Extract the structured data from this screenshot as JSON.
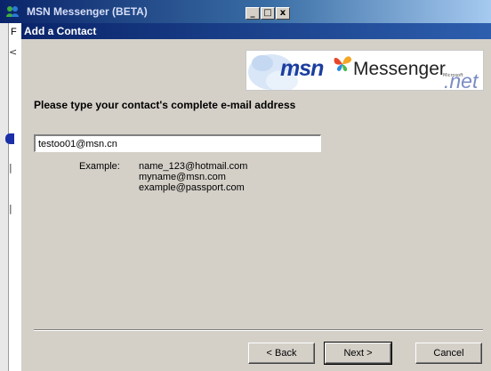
{
  "background_window": {
    "title": "MSN Messenger (BETA)",
    "controls": {
      "minimize": "_",
      "maximize": "□",
      "close": "x"
    },
    "menu_letter": "F",
    "marks": [
      "<",
      "|",
      "|"
    ]
  },
  "dialog": {
    "title": "Add a Contact",
    "banner": {
      "msn": "msn",
      "messenger": "Messenger",
      "microsoft": "Microsoft",
      "net": ".net"
    },
    "instruction": "Please type your contact's complete e-mail address",
    "email_input": {
      "value": "testoo01@msn.cn"
    },
    "example": {
      "label": "Example:",
      "lines": [
        "name_123@hotmail.com",
        "myname@msn.com",
        "example@passport.com"
      ]
    },
    "buttons": {
      "back": "< Back",
      "next": "Next >",
      "cancel": "Cancel"
    }
  },
  "colors": {
    "titlebar_dark": "#0a246a",
    "dialog_face": "#d4d0c8",
    "msn_blue": "#1c3ea0"
  }
}
